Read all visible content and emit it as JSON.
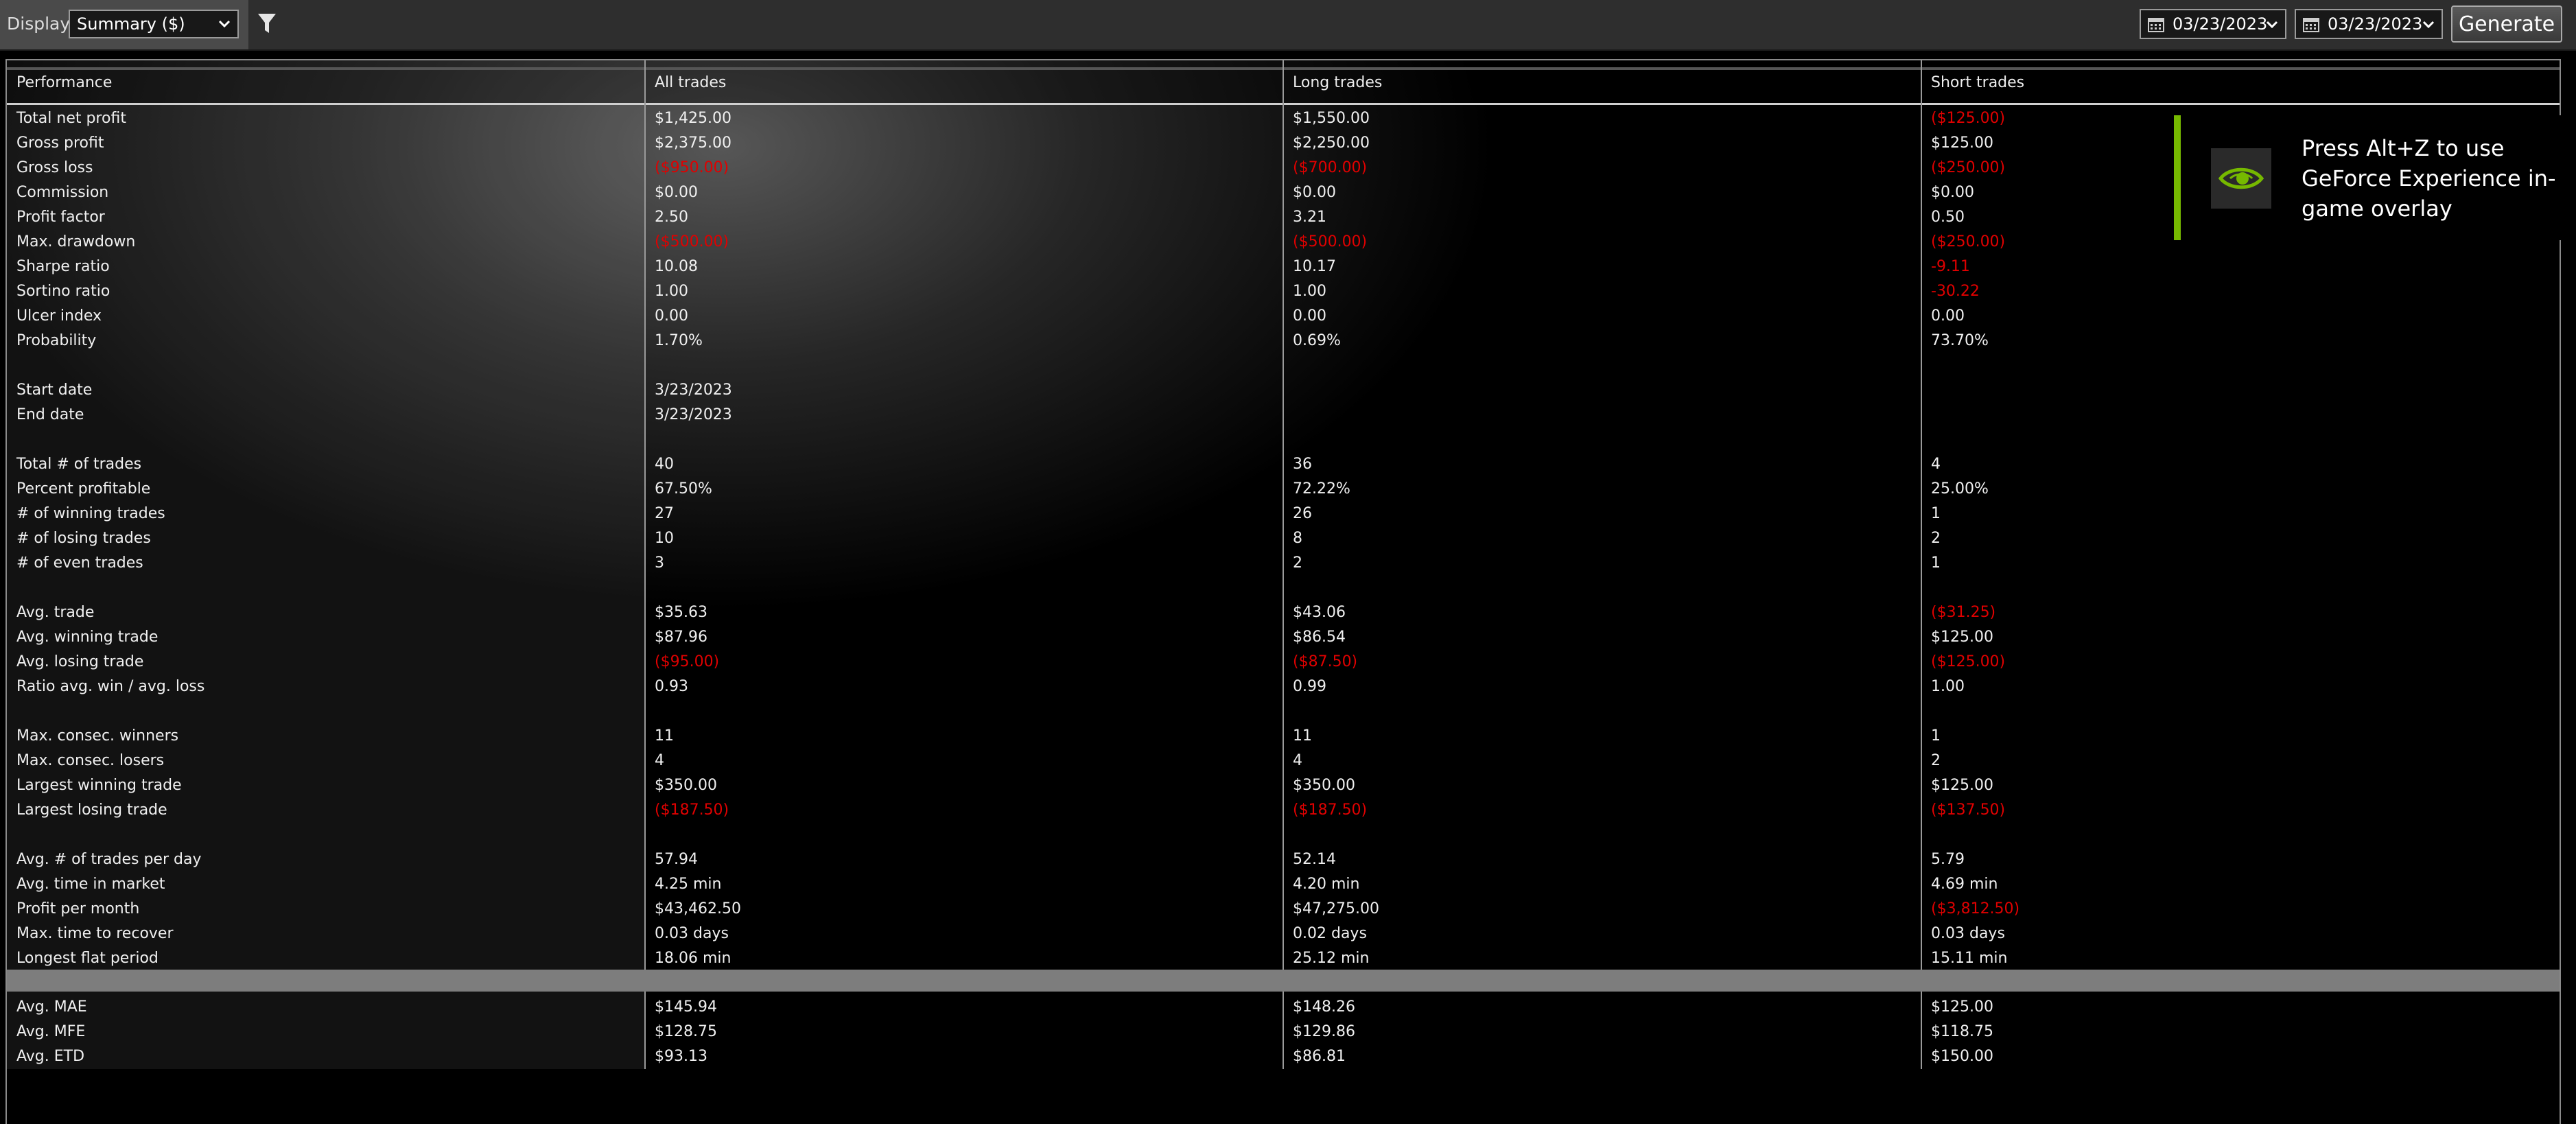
{
  "toolbar": {
    "display_label": "Display",
    "display_value": "Summary ($)",
    "date_from": "03/23/2023",
    "date_to": "03/23/2023",
    "generate_label": "Generate"
  },
  "table": {
    "headers": [
      "Performance",
      "All trades",
      "Long trades",
      "Short trades"
    ],
    "rows": [
      {
        "label": "Total net profit",
        "all": "$1,425.00",
        "long": "$1,550.00",
        "short": "($125.00)",
        "neg": [
          false,
          false,
          true
        ]
      },
      {
        "label": "Gross profit",
        "all": "$2,375.00",
        "long": "$2,250.00",
        "short": "$125.00",
        "neg": [
          false,
          false,
          false
        ]
      },
      {
        "label": "Gross loss",
        "all": "($950.00)",
        "long": "($700.00)",
        "short": "($250.00)",
        "neg": [
          true,
          true,
          true
        ]
      },
      {
        "label": "Commission",
        "all": "$0.00",
        "long": "$0.00",
        "short": "$0.00",
        "neg": [
          false,
          false,
          false
        ]
      },
      {
        "label": "Profit factor",
        "all": "2.50",
        "long": "3.21",
        "short": "0.50",
        "neg": [
          false,
          false,
          false
        ]
      },
      {
        "label": "Max. drawdown",
        "all": "($500.00)",
        "long": "($500.00)",
        "short": "($250.00)",
        "neg": [
          true,
          true,
          true
        ]
      },
      {
        "label": "Sharpe ratio",
        "all": "10.08",
        "long": "10.17",
        "short": "-9.11",
        "neg": [
          false,
          false,
          true
        ]
      },
      {
        "label": "Sortino ratio",
        "all": "1.00",
        "long": "1.00",
        "short": "-30.22",
        "neg": [
          false,
          false,
          true
        ]
      },
      {
        "label": "Ulcer index",
        "all": "0.00",
        "long": "0.00",
        "short": "0.00",
        "neg": [
          false,
          false,
          false
        ]
      },
      {
        "label": "Probability",
        "all": "1.70%",
        "long": "0.69%",
        "short": "73.70%",
        "neg": [
          false,
          false,
          false
        ]
      },
      {
        "label": "",
        "all": "",
        "long": "",
        "short": "",
        "neg": [
          false,
          false,
          false
        ]
      },
      {
        "label": "Start date",
        "all": "3/23/2023",
        "long": "",
        "short": "",
        "neg": [
          false,
          false,
          false
        ]
      },
      {
        "label": "End date",
        "all": "3/23/2023",
        "long": "",
        "short": "",
        "neg": [
          false,
          false,
          false
        ]
      },
      {
        "label": "",
        "all": "",
        "long": "",
        "short": "",
        "neg": [
          false,
          false,
          false
        ]
      },
      {
        "label": "Total # of trades",
        "all": "40",
        "long": "36",
        "short": "4",
        "neg": [
          false,
          false,
          false
        ]
      },
      {
        "label": "Percent profitable",
        "all": "67.50%",
        "long": "72.22%",
        "short": "25.00%",
        "neg": [
          false,
          false,
          false
        ]
      },
      {
        "label": "# of winning trades",
        "all": "27",
        "long": "26",
        "short": "1",
        "neg": [
          false,
          false,
          false
        ]
      },
      {
        "label": "# of losing trades",
        "all": "10",
        "long": "8",
        "short": "2",
        "neg": [
          false,
          false,
          false
        ]
      },
      {
        "label": "# of even trades",
        "all": "3",
        "long": "2",
        "short": "1",
        "neg": [
          false,
          false,
          false
        ]
      },
      {
        "label": "",
        "all": "",
        "long": "",
        "short": "",
        "neg": [
          false,
          false,
          false
        ]
      },
      {
        "label": "Avg. trade",
        "all": "$35.63",
        "long": "$43.06",
        "short": "($31.25)",
        "neg": [
          false,
          false,
          true
        ]
      },
      {
        "label": "Avg. winning trade",
        "all": "$87.96",
        "long": "$86.54",
        "short": "$125.00",
        "neg": [
          false,
          false,
          false
        ]
      },
      {
        "label": "Avg. losing trade",
        "all": "($95.00)",
        "long": "($87.50)",
        "short": "($125.00)",
        "neg": [
          true,
          true,
          true
        ]
      },
      {
        "label": "Ratio avg. win / avg. loss",
        "all": "0.93",
        "long": "0.99",
        "short": "1.00",
        "neg": [
          false,
          false,
          false
        ]
      },
      {
        "label": "",
        "all": "",
        "long": "",
        "short": "",
        "neg": [
          false,
          false,
          false
        ]
      },
      {
        "label": "Max. consec. winners",
        "all": "11",
        "long": "11",
        "short": "1",
        "neg": [
          false,
          false,
          false
        ]
      },
      {
        "label": "Max. consec. losers",
        "all": "4",
        "long": "4",
        "short": "2",
        "neg": [
          false,
          false,
          false
        ]
      },
      {
        "label": "Largest winning trade",
        "all": "$350.00",
        "long": "$350.00",
        "short": "$125.00",
        "neg": [
          false,
          false,
          false
        ]
      },
      {
        "label": "Largest losing trade",
        "all": "($187.50)",
        "long": "($187.50)",
        "short": "($137.50)",
        "neg": [
          true,
          true,
          true
        ]
      },
      {
        "label": "",
        "all": "",
        "long": "",
        "short": "",
        "neg": [
          false,
          false,
          false
        ]
      },
      {
        "label": "Avg. # of trades per day",
        "all": "57.94",
        "long": "52.14",
        "short": "5.79",
        "neg": [
          false,
          false,
          false
        ]
      },
      {
        "label": "Avg. time in market",
        "all": "4.25 min",
        "long": "4.20 min",
        "short": "4.69 min",
        "neg": [
          false,
          false,
          false
        ]
      },
      {
        "label": "Profit per month",
        "all": "$43,462.50",
        "long": "$47,275.00",
        "short": "($3,812.50)",
        "neg": [
          false,
          false,
          true
        ]
      },
      {
        "label": "Max. time to recover",
        "all": "0.03 days",
        "long": "0.02 days",
        "short": "0.03 days",
        "neg": [
          false,
          false,
          false
        ]
      },
      {
        "label": "Longest flat period",
        "all": "18.06 min",
        "long": "25.12 min",
        "short": "15.11 min",
        "neg": [
          false,
          false,
          false
        ]
      }
    ],
    "mae_rows": [
      {
        "label": "Avg. MAE",
        "all": "$145.94",
        "long": "$148.26",
        "short": "$125.00",
        "neg": [
          false,
          false,
          false
        ]
      },
      {
        "label": "Avg. MFE",
        "all": "$128.75",
        "long": "$129.86",
        "short": "$118.75",
        "neg": [
          false,
          false,
          false
        ]
      },
      {
        "label": "Avg. ETD",
        "all": "$93.13",
        "long": "$86.81",
        "short": "$150.00",
        "neg": [
          false,
          false,
          false
        ]
      }
    ]
  },
  "overlay": {
    "text": "Press Alt+Z to use GeForce Experience in-game overlay"
  },
  "icons": {
    "filter": "filter-icon",
    "calendar": "calendar-icon",
    "chevron": "chevron-down-icon",
    "nvidia": "nvidia-logo-icon"
  },
  "colors": {
    "negative": "#e00000",
    "nvidia_green": "#76b900"
  }
}
